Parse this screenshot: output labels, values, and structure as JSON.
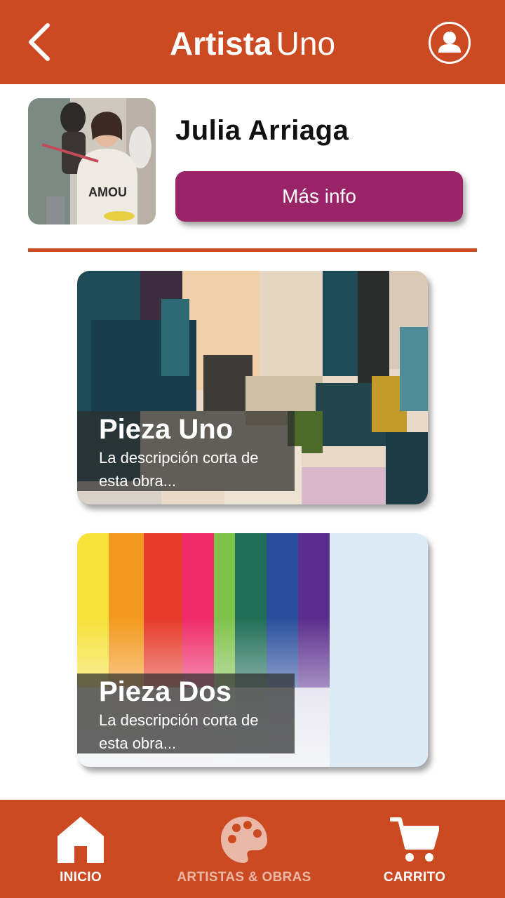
{
  "header": {
    "title_bold": "Artista",
    "title_light": "Uno",
    "back_icon": "chevron-left-icon",
    "profile_icon": "user-circle-icon"
  },
  "artist": {
    "name": "Julia Arriaga",
    "more_info_label": "Más info"
  },
  "artworks": [
    {
      "title": "Pieza Uno",
      "description": "La descripción corta de esta obra..."
    },
    {
      "title": "Pieza Dos",
      "description": "La descripción corta de esta obra..."
    }
  ],
  "nav": {
    "items": [
      {
        "label": "INICIO",
        "icon": "home-icon",
        "active": true
      },
      {
        "label": "ARTISTAS & OBRAS",
        "icon": "palette-icon",
        "active": false
      },
      {
        "label": "CARRITO",
        "icon": "cart-icon",
        "active": true
      }
    ]
  },
  "colors": {
    "brand": "#cc4a22",
    "button": "#9a2468",
    "nav_inactive": "#e9b8a6"
  }
}
